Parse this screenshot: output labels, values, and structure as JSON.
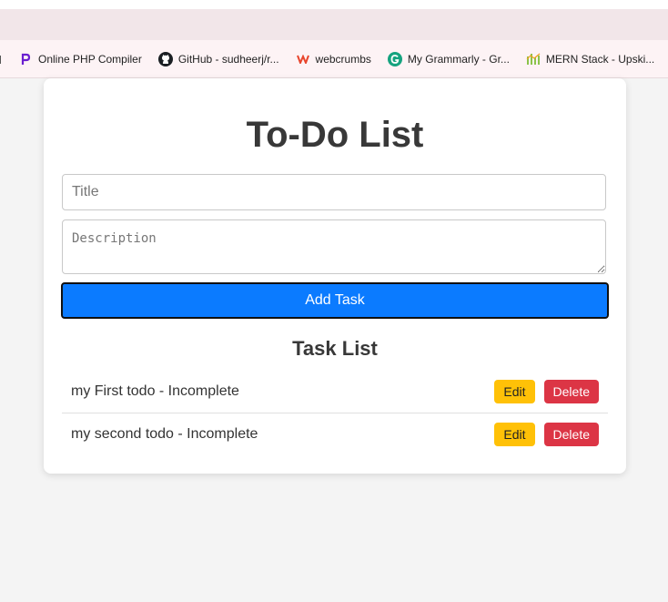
{
  "browser": {
    "bookmarks": [
      {
        "label": "Online PHP Compiler",
        "icon": "php-compiler-icon"
      },
      {
        "label": "GitHub - sudheerj/r...",
        "icon": "github-icon"
      },
      {
        "label": "webcrumbs",
        "icon": "webcrumbs-icon"
      },
      {
        "label": "My Grammarly - Gr...",
        "icon": "grammarly-icon"
      },
      {
        "label": "MERN Stack - Upski...",
        "icon": "mern-icon"
      }
    ]
  },
  "app": {
    "title": "To-Do List",
    "form": {
      "title_placeholder": "Title",
      "description_placeholder": "Description",
      "add_label": "Add Task"
    },
    "list_title": "Task List",
    "tasks": [
      {
        "text": "my First todo - Incomplete",
        "edit": "Edit",
        "delete": "Delete"
      },
      {
        "text": "my second todo - Incomplete",
        "edit": "Edit",
        "delete": "Delete"
      }
    ]
  },
  "colors": {
    "primary": "#0b7bff",
    "edit": "#ffc107",
    "delete": "#dc3545"
  }
}
